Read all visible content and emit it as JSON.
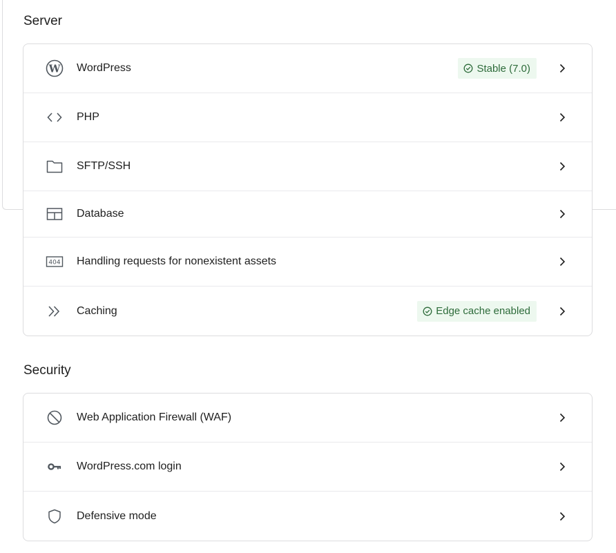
{
  "server": {
    "title": "Server",
    "items": [
      {
        "label": "WordPress",
        "icon": "wordpress-icon",
        "badge": "Stable (7.0)"
      },
      {
        "label": "PHP",
        "icon": "code-icon"
      },
      {
        "label": "SFTP/SSH",
        "icon": "folder-icon"
      },
      {
        "label": "Database",
        "icon": "table-icon"
      },
      {
        "label": "Handling requests for nonexistent assets",
        "icon": "404-icon",
        "icon_text": "404"
      },
      {
        "label": "Caching",
        "icon": "fast-forward-icon",
        "badge": "Edge cache enabled"
      }
    ]
  },
  "security": {
    "title": "Security",
    "items": [
      {
        "label": "Web Application Firewall (WAF)",
        "icon": "block-icon"
      },
      {
        "label": "WordPress.com login",
        "icon": "key-icon"
      },
      {
        "label": "Defensive mode",
        "icon": "shield-icon"
      }
    ]
  },
  "colors": {
    "badge_bg": "#edf8ef",
    "badge_text": "#2d6b3a",
    "border": "#dcdcde",
    "icon": "#50575e"
  }
}
